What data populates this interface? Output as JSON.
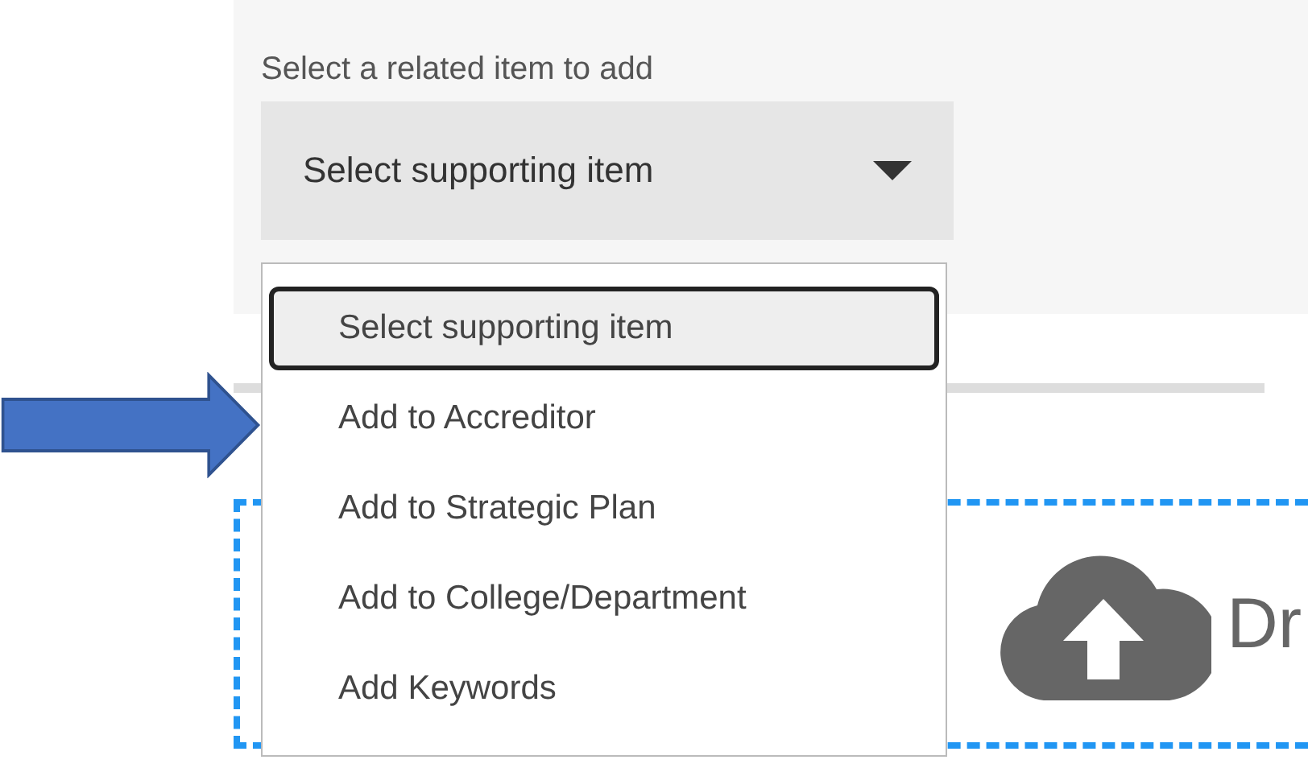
{
  "field": {
    "label": "Select a related item to add",
    "value": "Select supporting item"
  },
  "dropdown": {
    "options": [
      {
        "label": "Select supporting item",
        "selected": true
      },
      {
        "label": "Add to Accreditor",
        "selected": false
      },
      {
        "label": "Add to Strategic Plan",
        "selected": false
      },
      {
        "label": "Add to College/Department",
        "selected": false
      },
      {
        "label": "Add Keywords",
        "selected": false
      }
    ]
  },
  "upload": {
    "text": "Dr"
  }
}
